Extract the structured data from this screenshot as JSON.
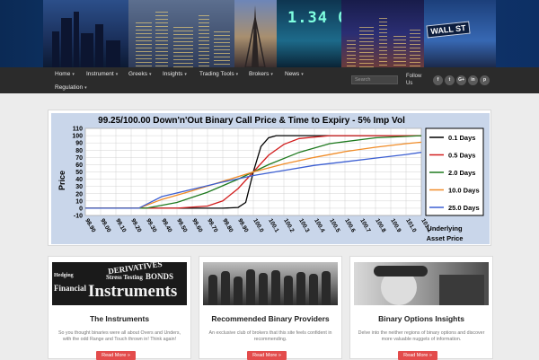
{
  "banner": {
    "ticker_text": "1.34 0",
    "wall_sign": "WALL ST"
  },
  "nav": {
    "items": [
      {
        "label": "Home"
      },
      {
        "label": "Instrument"
      },
      {
        "label": "Greeks"
      },
      {
        "label": "Insights"
      },
      {
        "label": "Trading Tools"
      },
      {
        "label": "Brokers"
      },
      {
        "label": "News"
      },
      {
        "label": "Regulation"
      }
    ],
    "search_placeholder": "Search",
    "follow_label": "Follow Us",
    "social": [
      {
        "icon": "facebook-icon",
        "glyph": "f"
      },
      {
        "icon": "twitter-icon",
        "glyph": "t"
      },
      {
        "icon": "google-plus-icon",
        "glyph": "G+"
      },
      {
        "icon": "linkedin-icon",
        "glyph": "in"
      },
      {
        "icon": "pinterest-icon",
        "glyph": "p"
      }
    ]
  },
  "chart_data": {
    "type": "line",
    "title": "99.25/100.00 Down'n'Out Binary Call Price & Time to Expiry - 5% Imp Vol",
    "ylabel": "Price",
    "xlabel": "Underlying Asset Price",
    "ylim": [
      -10,
      110
    ],
    "yticks": [
      -10,
      0,
      10,
      20,
      30,
      40,
      50,
      60,
      70,
      80,
      90,
      100,
      110
    ],
    "x_ticks": [
      "98.90",
      "99.00",
      "99.10",
      "99.20",
      "99.30",
      "99.40",
      "99.50",
      "99.60",
      "99.70",
      "99.80",
      "99.90",
      "100.0",
      "100.1",
      "100.2",
      "100.3",
      "100.4",
      "100.5",
      "100.6",
      "100.7",
      "100.8",
      "100.9",
      "101.0",
      "101.1"
    ],
    "grid": true,
    "legend_position": "right",
    "series": [
      {
        "name": "0.1 Days",
        "color": "#000000",
        "x": [
          98.9,
          99.6,
          99.8,
          99.9,
          99.95,
          100.0,
          100.05,
          100.1,
          100.15,
          100.2,
          100.3,
          101.1
        ],
        "values": [
          0,
          0,
          0,
          1,
          8,
          50,
          85,
          97,
          100,
          100,
          100,
          100
        ]
      },
      {
        "name": "0.5 Days",
        "color": "#d21e1e",
        "x": [
          98.9,
          99.5,
          99.7,
          99.8,
          99.9,
          100.0,
          100.1,
          100.2,
          100.3,
          100.5,
          101.1
        ],
        "values": [
          0,
          0,
          3,
          10,
          27,
          50,
          73,
          88,
          96,
          100,
          100
        ]
      },
      {
        "name": "2.0 Days",
        "color": "#1f7a1f",
        "x": [
          98.9,
          99.3,
          99.5,
          99.7,
          99.9,
          100.0,
          100.1,
          100.3,
          100.5,
          100.8,
          101.1
        ],
        "values": [
          0,
          0,
          8,
          22,
          40,
          50,
          60,
          77,
          89,
          97,
          100
        ]
      },
      {
        "name": "10.0 Days",
        "color": "#f08c28",
        "x": [
          98.9,
          99.25,
          99.4,
          99.6,
          99.8,
          100.0,
          100.2,
          100.4,
          100.6,
          100.8,
          101.0,
          101.1
        ],
        "values": [
          0,
          0,
          12,
          24,
          37,
          50,
          61,
          70,
          78,
          84,
          89,
          91
        ]
      },
      {
        "name": "25.0 Days",
        "color": "#3c5fd2",
        "x": [
          98.9,
          99.25,
          99.4,
          99.6,
          99.8,
          100.0,
          100.2,
          100.4,
          100.6,
          100.8,
          101.0,
          101.1
        ],
        "values": [
          0,
          0,
          16,
          26,
          36,
          45,
          52,
          59,
          64,
          69,
          74,
          77
        ]
      }
    ]
  },
  "cards": [
    {
      "title": "The Instruments",
      "text": "So you thought binaries were all about Overs and Unders, with the odd Range and Touch thrown in! Think again!",
      "button": "Read More »",
      "image_words": [
        "DERIVATIVES",
        "Stress Testing",
        "BONDS",
        "Hedging",
        "Financial",
        "Instruments"
      ]
    },
    {
      "title": "Recommended Binary Providers",
      "text": "An exclusive club of brokers that this site feels confident in recommending.",
      "button": "Read More »"
    },
    {
      "title": "Binary Options Insights",
      "text": "Delve into the neither regions of binary options and discover more valuable nuggets of information.",
      "button": "Read More »"
    }
  ]
}
